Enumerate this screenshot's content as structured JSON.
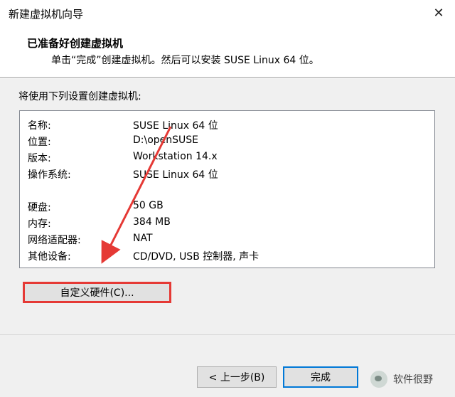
{
  "window": {
    "title": "新建虚拟机向导",
    "close_glyph": "✕"
  },
  "header": {
    "title": "已准备好创建虚拟机",
    "subtitle": "单击“完成”创建虚拟机。然后可以安装 SUSE Linux 64 位。"
  },
  "main": {
    "prompt": "将使用下列设置创建虚拟机:",
    "settings": [
      {
        "key": "名称:",
        "value": "SUSE Linux 64 位"
      },
      {
        "key": "位置:",
        "value": "D:\\openSUSE"
      },
      {
        "key": "版本:",
        "value": "Workstation 14.x"
      },
      {
        "key": "操作系统:",
        "value": "SUSE Linux 64 位"
      },
      {
        "key": "硬盘:",
        "value": "50 GB"
      },
      {
        "key": "内存:",
        "value": "384 MB"
      },
      {
        "key": "网络适配器:",
        "value": "NAT"
      },
      {
        "key": "其他设备:",
        "value": "CD/DVD, USB 控制器, 声卡"
      }
    ],
    "customize_label": "自定义硬件(C)..."
  },
  "footer": {
    "back_label": "< 上一步(B)",
    "finish_label": "完成"
  },
  "watermark": {
    "text": "软件很野"
  },
  "colors": {
    "highlight": "#e53935",
    "focus": "#0078d7",
    "dialog_bg": "#f0f0f0"
  }
}
